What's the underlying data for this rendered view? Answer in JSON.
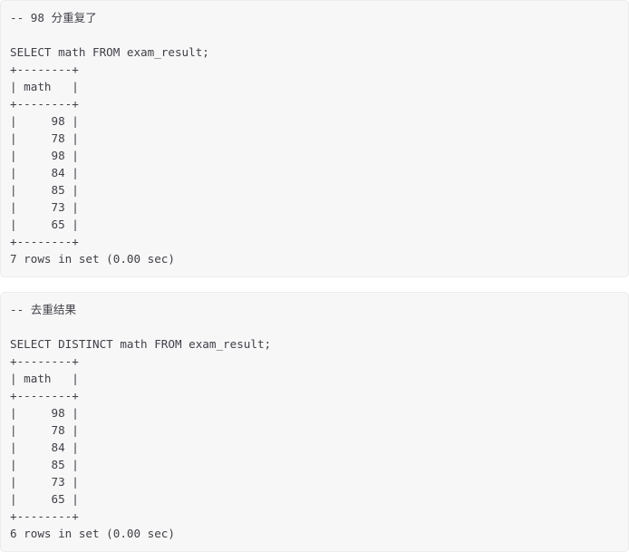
{
  "page": {
    "background_color": "#ffffff",
    "block_background_color": "#f7f7f8",
    "block_border_color": "#ececec",
    "text_color": "#3f3f46"
  },
  "blocks": [
    {
      "name": "duplicate-values-block",
      "comment": "-- 98 分重复了",
      "query": "SELECT math FROM exam_result;",
      "table": {
        "separator": "+--------+",
        "header": "| math   |",
        "column": "math",
        "rows": [
          "|     98 |",
          "|     78 |",
          "|     98 |",
          "|     84 |",
          "|     85 |",
          "|     73 |",
          "|     65 |"
        ],
        "values": [
          98,
          78,
          98,
          84,
          85,
          73,
          65
        ]
      },
      "status": "7 rows in set (0.00 sec)",
      "row_count": 7,
      "elapsed": "0.00 sec",
      "text": "-- 98 分重复了\n\nSELECT math FROM exam_result;\n+--------+\n| math   |\n+--------+\n|     98 |\n|     78 |\n|     98 |\n|     84 |\n|     85 |\n|     73 |\n|     65 |\n+--------+\n7 rows in set (0.00 sec)"
    },
    {
      "name": "distinct-values-block",
      "comment": "-- 去重结果",
      "query": "SELECT DISTINCT math FROM exam_result;",
      "table": {
        "separator": "+--------+",
        "header": "| math   |",
        "column": "math",
        "rows": [
          "|     98 |",
          "|     78 |",
          "|     84 |",
          "|     85 |",
          "|     73 |",
          "|     65 |"
        ],
        "values": [
          98,
          78,
          84,
          85,
          73,
          65
        ]
      },
      "status": "6 rows in set (0.00 sec)",
      "row_count": 6,
      "elapsed": "0.00 sec",
      "text": "-- 去重结果\n\nSELECT DISTINCT math FROM exam_result;\n+--------+\n| math   |\n+--------+\n|     98 |\n|     78 |\n|     84 |\n|     85 |\n|     73 |\n|     65 |\n+--------+\n6 rows in set (0.00 sec)"
    }
  ]
}
